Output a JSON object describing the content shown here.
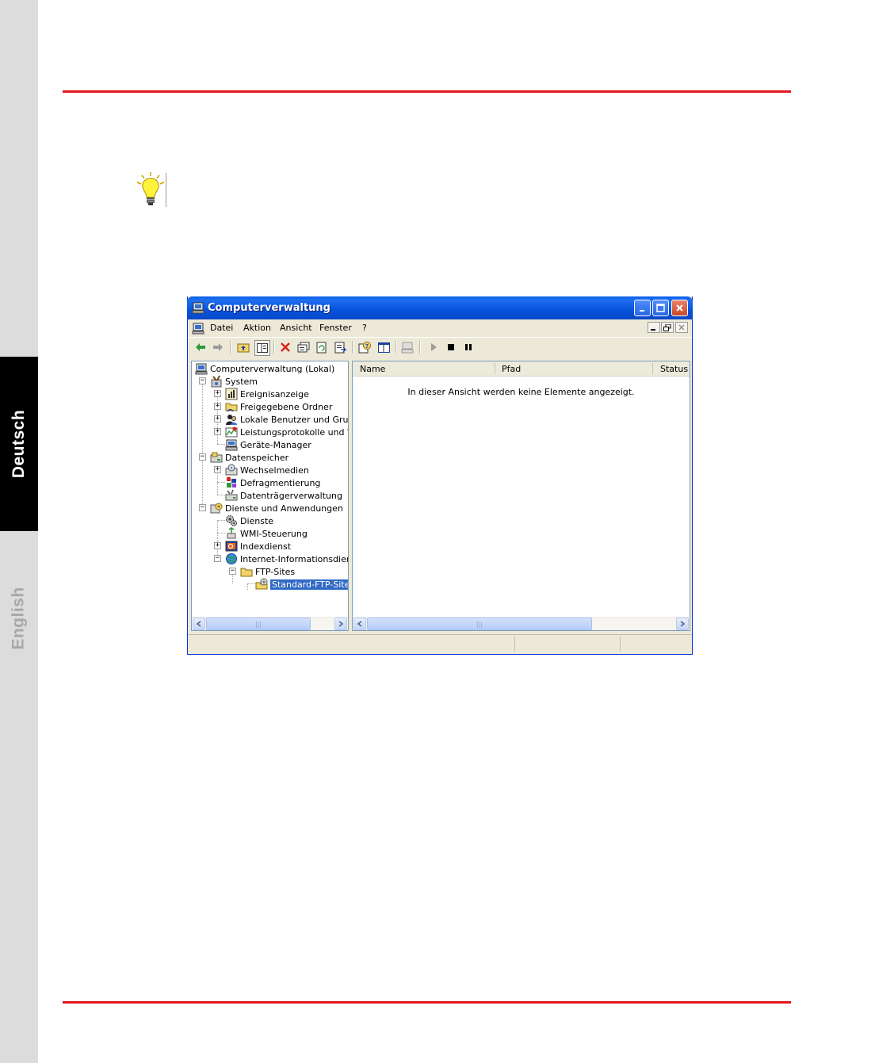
{
  "sidebar": {
    "tabs": [
      {
        "label": "Deutsch",
        "active": true
      },
      {
        "label": "English",
        "active": false
      }
    ]
  },
  "colors": {
    "accent_rule": "#e3161f",
    "titlebar": "#0a5ee8",
    "selection": "#316ac5"
  },
  "window": {
    "title": "Computerverwaltung",
    "menu": [
      "Datei",
      "Aktion",
      "Ansicht",
      "Fenster",
      "?"
    ],
    "toolbar_icons": [
      "back-icon",
      "forward-icon",
      "up-folder-icon",
      "show-tree-icon",
      "delete-icon",
      "properties-icon",
      "refresh-icon",
      "export-icon",
      "help-icon",
      "console-icon",
      "computer-icon",
      "play-icon",
      "stop-icon",
      "pause-icon"
    ],
    "tree": [
      {
        "label": "Computerverwaltung (Lokal)",
        "icon": "computer-icon"
      },
      {
        "label": "System",
        "icon": "tools-icon"
      },
      {
        "label": "Ereignisanzeige",
        "icon": "event-viewer-icon"
      },
      {
        "label": "Freigegebene Ordner",
        "icon": "shared-folder-icon"
      },
      {
        "label": "Lokale Benutzer und Gruppe",
        "icon": "users-icon"
      },
      {
        "label": "Leistungsprotokolle und War",
        "icon": "performance-icon"
      },
      {
        "label": "Geräte-Manager",
        "icon": "device-manager-icon"
      },
      {
        "label": "Datenspeicher",
        "icon": "storage-icon"
      },
      {
        "label": "Wechselmedien",
        "icon": "removable-media-icon"
      },
      {
        "label": "Defragmentierung",
        "icon": "defrag-icon"
      },
      {
        "label": "Datenträgerverwaltung",
        "icon": "disk-management-icon"
      },
      {
        "label": "Dienste und Anwendungen",
        "icon": "services-apps-icon"
      },
      {
        "label": "Dienste",
        "icon": "services-icon"
      },
      {
        "label": "WMI-Steuerung",
        "icon": "wmi-icon"
      },
      {
        "label": "Indexdienst",
        "icon": "index-icon"
      },
      {
        "label": "Internet-Informationsdienst",
        "icon": "iis-icon"
      },
      {
        "label": "FTP-Sites",
        "icon": "folder-icon"
      },
      {
        "label": "Standard-FTP-Site",
        "icon": "ftp-site-icon",
        "selected": true
      }
    ],
    "list": {
      "columns": [
        "Name",
        "Pfad",
        "Status"
      ],
      "empty_message": "In dieser Ansicht werden keine Elemente angezeigt."
    }
  }
}
